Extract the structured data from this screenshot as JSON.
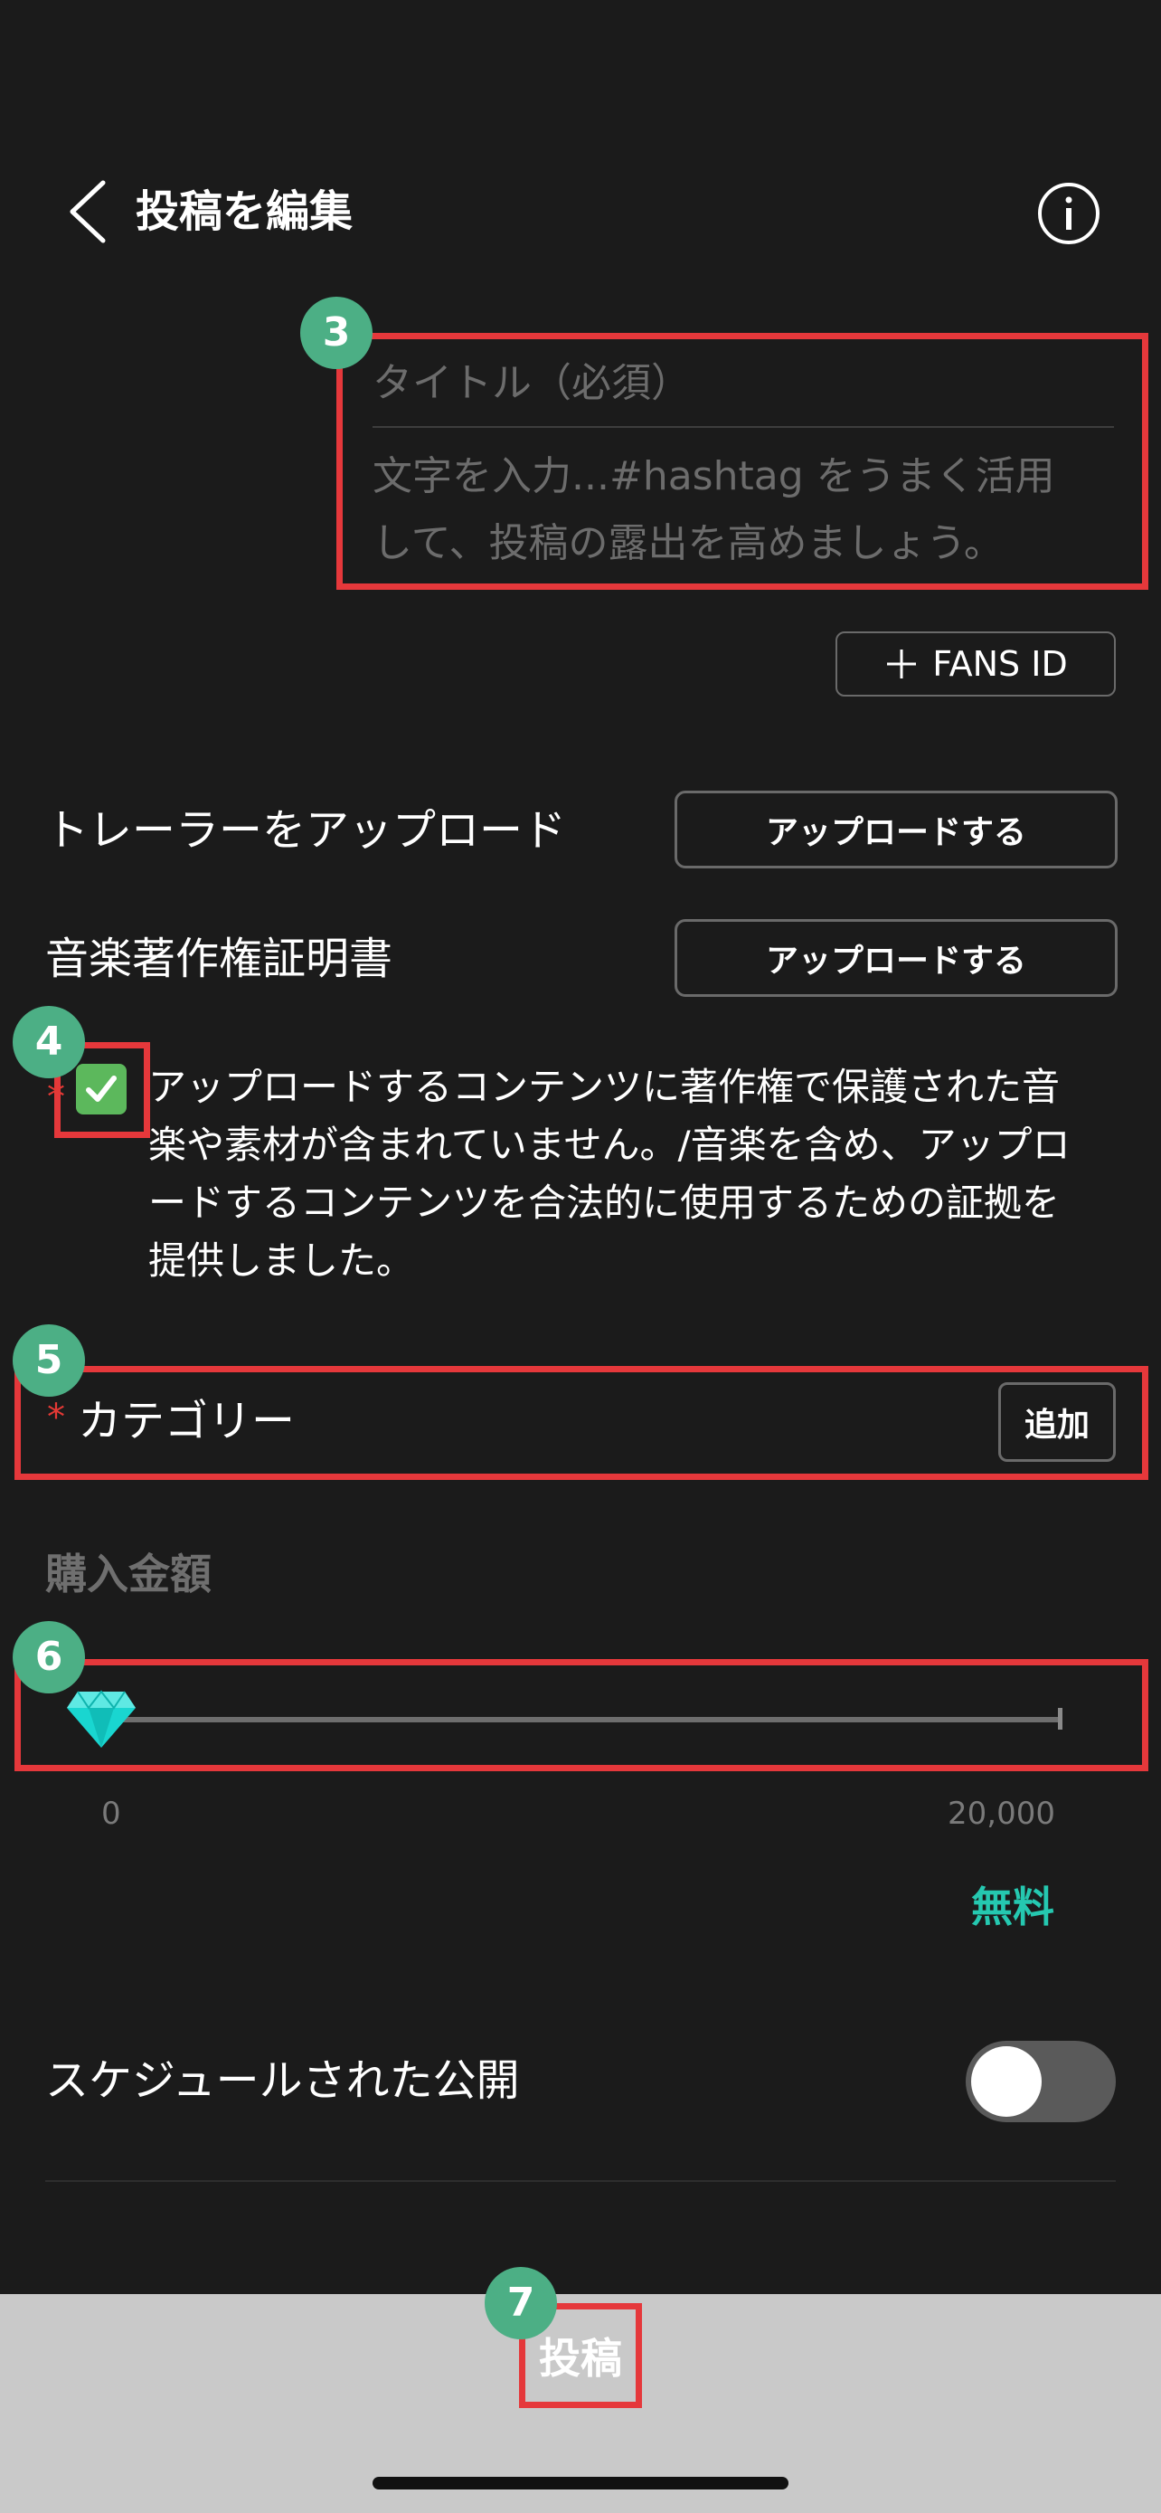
{
  "header": {
    "title": "投稿を編集",
    "back_icon": "chevron-left-icon",
    "info_icon": "info-circle-icon"
  },
  "post_form": {
    "title_placeholder": "タイトル（必須）",
    "description_placeholder_line1": "文字を入力...#hashtag をうまく活用",
    "description_placeholder_line2": "して、投稿の露出を高めましょう。",
    "fans_id_button": "FANS ID"
  },
  "uploads": [
    {
      "label": "トレーラーをアップロード",
      "button": "アップロードする"
    },
    {
      "label": "音楽著作権証明書",
      "button": "アップロードする"
    }
  ],
  "consent": {
    "required_mark": "*",
    "checked": true,
    "line1": "アップロードするコンテンツに著作権で保護された音",
    "line2": "楽や素材が含まれていません。/音楽を含め、アップロ",
    "line3": "ードするコンテンツを合法的に使用するための証拠を",
    "line4": "提供しました。"
  },
  "category": {
    "required_mark": "*",
    "label": "カテゴリー",
    "add_button": "追加"
  },
  "price": {
    "title": "購入金額",
    "slider_min": "0",
    "slider_max": "20,000",
    "slider_value": 0,
    "value_label": "無料",
    "thumb_icon": "diamond-icon"
  },
  "schedule": {
    "label": "スケジュールされた公開",
    "enabled": false
  },
  "footer": {
    "post_button": "投稿"
  },
  "annotations": [
    "3",
    "4",
    "5",
    "6",
    "7"
  ],
  "colors": {
    "background": "#1b1b1b",
    "accent": "#25c8b0",
    "annotation_box": "#e5383b",
    "badge": "#4caf85",
    "bottom_bar": "#c9c9c9"
  }
}
